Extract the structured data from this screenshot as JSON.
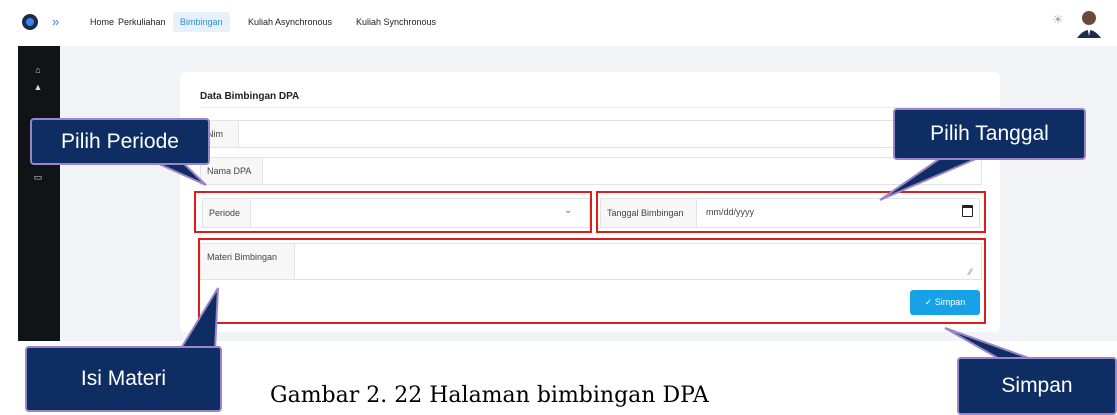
{
  "nav": {
    "items": [
      "Home",
      "Perkuliahan",
      "Bimbingan",
      "Kuliah Asynchronous",
      "Kuliah Synchronous"
    ],
    "active": "Bimbingan"
  },
  "form": {
    "title": "Data Bimbingan DPA",
    "nim_label": "Nim",
    "nama_dpa_label": "Nama DPA",
    "periode_label": "Periode",
    "tanggal_label": "Tanggal Bimbingan",
    "tanggal_placeholder": "mm/dd/yyyy",
    "materi_label": "Materi Bimbingan",
    "simpan_label": "✓ Simpan"
  },
  "callouts": {
    "pilih_periode": "Pilih Periode",
    "pilih_tanggal": "Pilih Tanggal",
    "isi_materi": "Isi Materi",
    "simpan": "Simpan"
  },
  "caption": "Gambar 2. 22 Halaman bimbingan DPA",
  "colors": {
    "accent": "#17a2e8",
    "callout_bg": "#0e2d63",
    "highlight": "#e01b1b",
    "sidebar": "#111416"
  }
}
